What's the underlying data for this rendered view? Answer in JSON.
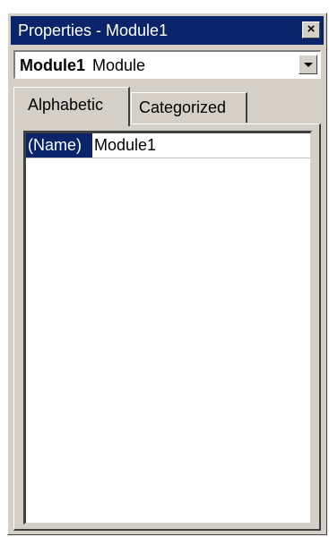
{
  "window": {
    "title": "Properties - Module1",
    "close_glyph": "×"
  },
  "object_selector": {
    "object_name": "Module1",
    "object_type": "Module",
    "dropdown_icon": "chevron-down-icon"
  },
  "tabs": [
    {
      "label": "Alphabetic",
      "selected": true
    },
    {
      "label": "Categorized",
      "selected": false
    }
  ],
  "properties": [
    {
      "name": "(Name)",
      "value": "Module1",
      "selected": true
    }
  ],
  "colors": {
    "titlebar": "#0a246a",
    "face": "#d4d0c8",
    "selection": "#0a246a"
  }
}
